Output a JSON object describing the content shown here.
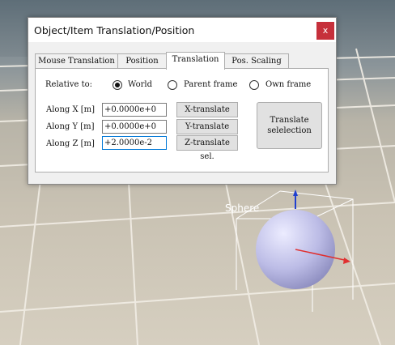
{
  "window": {
    "title": "Object/Item Translation/Position",
    "close_label": "x"
  },
  "tabs": [
    {
      "label": "Mouse Translation"
    },
    {
      "label": "Position"
    },
    {
      "label": "Translation"
    },
    {
      "label": "Pos. Scaling"
    }
  ],
  "active_tab": "Translation",
  "relative": {
    "label": "Relative to:",
    "options": [
      {
        "label": "World",
        "selected": true
      },
      {
        "label": "Parent frame",
        "selected": false
      },
      {
        "label": "Own frame",
        "selected": false
      }
    ]
  },
  "axes": [
    {
      "label": "Along X [m]",
      "value": "+0.0000e+0",
      "button": "X-translate sel."
    },
    {
      "label": "Along Y [m]",
      "value": "+0.0000e+0",
      "button": "Y-translate sel."
    },
    {
      "label": "Along Z [m]",
      "value": "+2.0000e-2",
      "button": "Z-translate sel."
    }
  ],
  "translate_button": {
    "line1": "Translate",
    "line2": "selelection"
  },
  "scene": {
    "object_label": "Sphere"
  },
  "colors": {
    "close": "#c6303b",
    "focus": "#0078d7",
    "sphere": "#c9c9ec",
    "axis_x": "#e03030",
    "axis_z": "#2040d0"
  }
}
